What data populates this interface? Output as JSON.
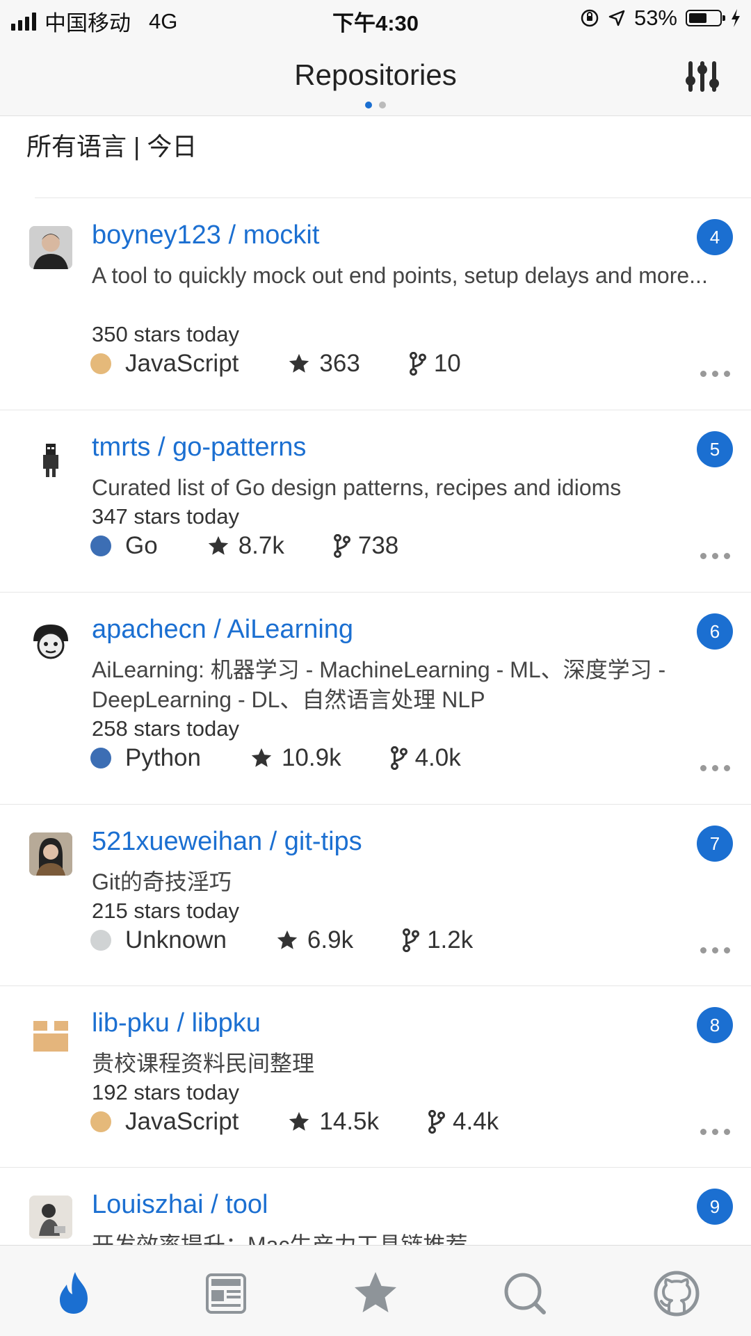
{
  "status_bar": {
    "carrier": "中国移动",
    "network": "4G",
    "time": "下午4:30",
    "battery": "53%"
  },
  "nav": {
    "title": "Repositories"
  },
  "filter": {
    "label": "所有语言 | 今日"
  },
  "repos": [
    {
      "rank": "4",
      "name": "boyney123 / mockit",
      "description": "A tool to quickly mock out end points, setup delays and more...",
      "stars_today": "350 stars today",
      "language": "JavaScript",
      "language_color": "#e5b97a",
      "stars": "363",
      "forks": "10"
    },
    {
      "rank": "5",
      "name": "tmrts / go-patterns",
      "description": "Curated list of Go design patterns, recipes and idioms",
      "stars_today": "347 stars today",
      "language": "Go",
      "language_color": "#3c6eb4",
      "stars": "8.7k",
      "forks": "738"
    },
    {
      "rank": "6",
      "name": "apachecn / AiLearning",
      "description": "AiLearning: 机器学习 - MachineLearning - ML、深度学习 - DeepLearning - DL、自然语言处理 NLP",
      "stars_today": "258 stars today",
      "language": "Python",
      "language_color": "#3c6eb4",
      "stars": "10.9k",
      "forks": "4.0k"
    },
    {
      "rank": "7",
      "name": "521xueweihan / git-tips",
      "description": "Git的奇技淫巧",
      "stars_today": "215 stars today",
      "language": "Unknown",
      "language_color": "#d0d3d4",
      "stars": "6.9k",
      "forks": "1.2k"
    },
    {
      "rank": "8",
      "name": "lib-pku / libpku",
      "description": "贵校课程资料民间整理",
      "stars_today": "192 stars today",
      "language": "JavaScript",
      "language_color": "#e5b97a",
      "stars": "14.5k",
      "forks": "4.4k"
    },
    {
      "rank": "9",
      "name": "Louiszhai / tool",
      "description": "开发效率提升：Mac生产力工具链推荐"
    }
  ],
  "tab_icons": [
    "flame-icon",
    "news-icon",
    "star-icon",
    "search-icon",
    "github-icon"
  ],
  "colors": {
    "accent": "#1b6fd1",
    "tab_inactive": "#8e9499"
  }
}
